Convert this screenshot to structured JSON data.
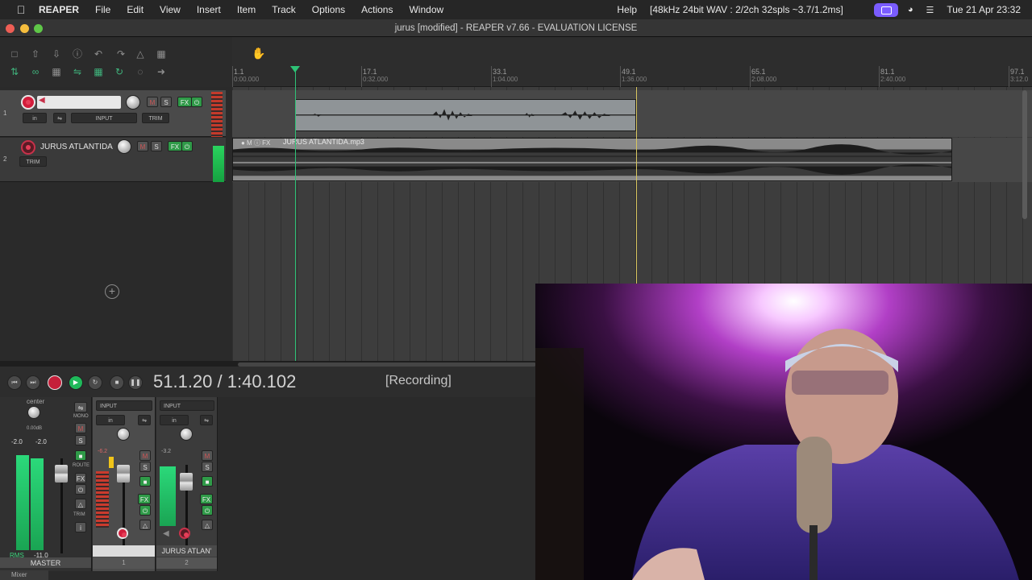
{
  "menubar": {
    "app": "REAPER",
    "items": [
      "File",
      "Edit",
      "View",
      "Insert",
      "Item",
      "Track",
      "Options",
      "Actions",
      "Window"
    ],
    "help": "Help",
    "audio_status": "[48kHz 24bit WAV : 2/2ch 32spls ~3.7/1.2ms]",
    "datetime": "Tue 21 Apr  23:32"
  },
  "window": {
    "title": "jurus [modified] - REAPER v7.66 - EVALUATION LICENSE"
  },
  "ruler": {
    "marks": [
      {
        "bar": "1.1",
        "time": "0:00.000"
      },
      {
        "bar": "17.1",
        "time": "0:32.000"
      },
      {
        "bar": "33.1",
        "time": "1:04.000"
      },
      {
        "bar": "49.1",
        "time": "1:36.000"
      },
      {
        "bar": "65.1",
        "time": "2:08.000"
      },
      {
        "bar": "81.1",
        "time": "2:40.000"
      },
      {
        "bar": "97.1",
        "time": "3:12.0"
      }
    ]
  },
  "tracks": [
    {
      "number": "1",
      "name": "",
      "input_label": "INPUT",
      "in_label": "in",
      "mute": "M",
      "solo": "S",
      "fx": "FX",
      "trim": "TRIM"
    },
    {
      "number": "2",
      "name": "JURUS ATLANTIDA",
      "mute": "M",
      "solo": "S",
      "fx": "FX",
      "trim": "TRIM"
    }
  ],
  "items": [
    {
      "track": "1",
      "label": ""
    },
    {
      "track": "2",
      "label": "JURUS ATLANTIDA.mp3"
    }
  ],
  "transport": {
    "position": "51.1.20 / 1:40.102",
    "state": "[Recording]"
  },
  "mixer": {
    "master": {
      "pan": "center",
      "gain": "0.00dB",
      "peak_l": "-2.0",
      "peak_r": "-2.0",
      "rms_label": "RMS",
      "rms_value": "-11.0",
      "name": "MASTER",
      "mono": "MONO",
      "route": "ROUTE",
      "trim": "TRIM",
      "mute": "M",
      "solo": "S",
      "fx": "FX"
    },
    "strips": [
      {
        "number": "1",
        "name": "",
        "input_label": "INPUT",
        "in_label": "in",
        "peak": "-6.2",
        "mute": "M",
        "solo": "S",
        "fx": "FX"
      },
      {
        "number": "2",
        "name": "JURUS ATLAN'",
        "input_label": "INPUT",
        "in_label": "in",
        "peak": "-3.2",
        "mute": "M",
        "solo": "S",
        "fx": "FX"
      }
    ],
    "tab_label": "Mixer"
  },
  "colors": {
    "rec_red": "#d21d3b",
    "play_green": "#1fb95a",
    "fx_green": "#2f9a48",
    "edit_cursor": "#2ec276",
    "play_cursor": "#d8c660"
  }
}
